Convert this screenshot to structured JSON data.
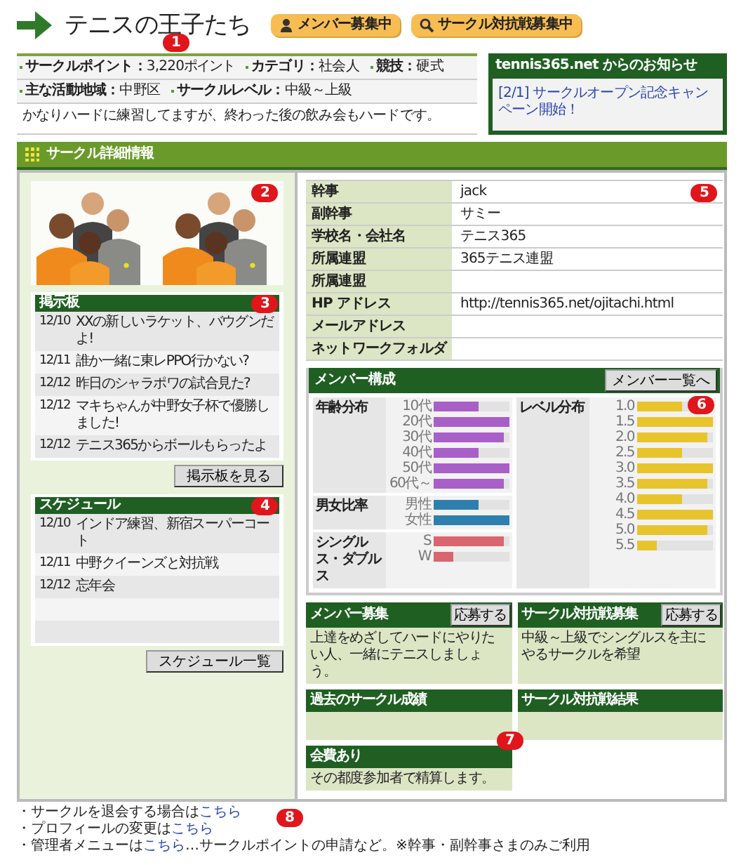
{
  "header": {
    "title": "テニスの王子たち",
    "badges": [
      {
        "kind": "member",
        "label": "メンバー募集中"
      },
      {
        "kind": "match",
        "label": "サークル対抗戦募集中"
      }
    ]
  },
  "summary": {
    "callout": "1",
    "rows": [
      [
        {
          "label": "サークルポイント：",
          "value": "3,220",
          "unit": "ポイント"
        },
        {
          "label": "カテゴリ：",
          "value": "社会人"
        },
        {
          "label": "競技：",
          "value": "硬式"
        }
      ],
      [
        {
          "label": "主な活動地域：",
          "value": "中野区"
        },
        {
          "label": "サークルレベル：",
          "value": "中級～上級"
        }
      ]
    ],
    "description": "かなりハードに練習してますが、終わった後の飲み会もハードです。"
  },
  "notice": {
    "title": "tennis365.net からのお知らせ",
    "items": [
      "[2/1] サークルオープン記念キャンペーン開始！"
    ]
  },
  "section": {
    "title": "サークル詳細情報"
  },
  "photos": {
    "callout": "2"
  },
  "board": {
    "title": "掲示板",
    "callout": "3",
    "button": "掲示板を見る",
    "posts": [
      {
        "date": "12/10",
        "text": "XXの新しいラケット、バウグンだよ!"
      },
      {
        "date": "12/11",
        "text": "誰か一緒に東レPPO行かない?"
      },
      {
        "date": "12/12",
        "text": "昨日のシャラポワの試合見た?"
      },
      {
        "date": "12/12",
        "text": "マキちゃんが中野女子杯で優勝しました!"
      },
      {
        "date": "12/12",
        "text": "テニス365からボールもらったよ"
      }
    ]
  },
  "schedule": {
    "title": "スケジュール",
    "callout": "4",
    "button": "スケジュール一覧",
    "events": [
      {
        "date": "12/10",
        "text": "インドア練習、新宿スーパーコート"
      },
      {
        "date": "12/11",
        "text": "中野クイーンズと対抗戦"
      },
      {
        "date": "12/12",
        "text": "忘年会"
      }
    ]
  },
  "profile": {
    "callout": "5",
    "rows": [
      {
        "label": "幹事",
        "value": "jack"
      },
      {
        "label": "副幹事",
        "value": "サミー"
      },
      {
        "label": "学校名・会社名",
        "value": "テニス365"
      },
      {
        "label": "所属連盟",
        "value": "365テニス連盟"
      },
      {
        "label": "所属連盟"
      },
      {
        "label": "HP アドレス",
        "value": "http://tennis365.net/ojitachi.html"
      },
      {
        "label": "メールアドレス"
      },
      {
        "label": "ネットワークフォルダ"
      }
    ]
  },
  "members": {
    "title": "メンバー構成",
    "button": "メンバー一覧へ",
    "callout": "6",
    "groups": [
      {
        "title": "年齢分布",
        "color": "#a95fc8",
        "bars": [
          {
            "label": "10代",
            "level": 0.6
          },
          {
            "label": "20代",
            "level": 1
          },
          {
            "label": "30代",
            "level": 0.93
          },
          {
            "label": "40代",
            "level": 0.6
          },
          {
            "label": "50代",
            "level": 1
          },
          {
            "label": "60代～",
            "level": 0.93
          }
        ]
      },
      {
        "title": "男女比率",
        "color": "#2f7fae",
        "bars": [
          {
            "label": "男性",
            "level": 0.6
          },
          {
            "label": "女性",
            "level": 1
          }
        ]
      },
      {
        "title": "シングルス・ダブルス",
        "color": "#d9666e",
        "bars": [
          {
            "label": "S",
            "level": 0.93
          },
          {
            "label": "W",
            "level": 0.25
          }
        ]
      }
    ],
    "levels": {
      "title": "レベル分布",
      "color": "#e8c42c",
      "bars": [
        {
          "label": "1.0",
          "level": 0.6
        },
        {
          "label": "1.5",
          "level": 1
        },
        {
          "label": "2.0",
          "level": 0.93
        },
        {
          "label": "2.5",
          "level": 0.6
        },
        {
          "label": "3.0",
          "level": 1
        },
        {
          "label": "3.5",
          "level": 0.93
        },
        {
          "label": "4.0",
          "level": 0.6
        },
        {
          "label": "4.5",
          "level": 1
        },
        {
          "label": "5.0",
          "level": 0.93
        },
        {
          "label": "5.5",
          "level": 0.25
        }
      ]
    }
  },
  "recruit": [
    {
      "title": "メンバー募集",
      "button": "応募する",
      "text": "上達をめざしてハードにやりたい人、一緒にテニスしましょう。"
    },
    {
      "title": "サークル対抗戦募集",
      "button": "応募する",
      "text": "中級～上級でシングルスを主にやるサークルを希望"
    }
  ],
  "results": {
    "callout": "7",
    "boxes": [
      {
        "title": "過去のサークル成績"
      },
      {
        "title": "サークル対抗戦結果"
      }
    ]
  },
  "fee": {
    "title": "会費あり",
    "text": "その都度参加者で精算します。"
  },
  "footer": {
    "callout": "8",
    "lines": [
      {
        "text": "・サークルを退会する場合は",
        "link": "こちら"
      },
      {
        "text": "・プロフィールの変更は",
        "link": "こちら"
      },
      {
        "text": "・管理者メニューは",
        "link": "こちら",
        "after": "…サークルポイントの申請など。※幹事・副幹事さまのみご利用"
      }
    ]
  }
}
